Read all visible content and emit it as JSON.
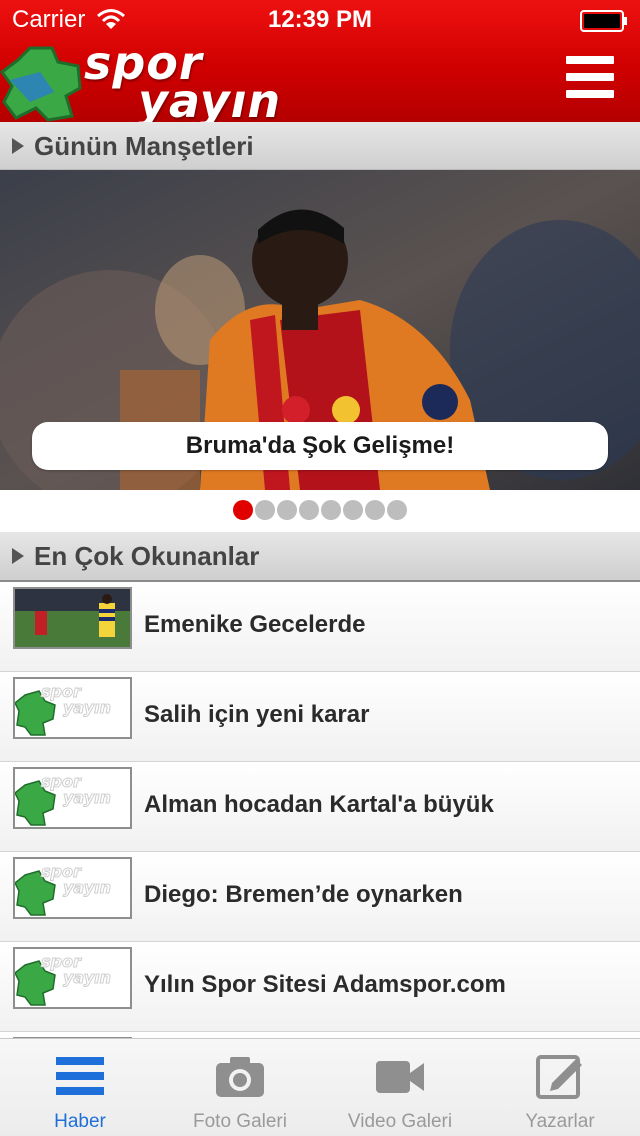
{
  "status_bar": {
    "carrier": "Carrier",
    "time": "12:39 PM"
  },
  "brand": {
    "logo_line1": "spor",
    "logo_line2": "yayın",
    "primary_color": "#d40000",
    "accent_green": "#3aa845"
  },
  "header": {
    "menu_icon": "hamburger-menu-icon"
  },
  "sections": {
    "headlines_title": "Günün Manşetleri",
    "most_read_title": "En Çok Okunanlar"
  },
  "carousel": {
    "caption": "Bruma'da Şok Gelişme!",
    "page_count": 8,
    "active_page": 1
  },
  "news_list": [
    {
      "title": "Emenike Gecelerde",
      "thumbnail": "photo"
    },
    {
      "title": "Salih için yeni karar",
      "thumbnail": "logo"
    },
    {
      "title": "Alman hocadan Kartal'a büyük",
      "thumbnail": "logo"
    },
    {
      "title": "Diego: Bremen’de oynarken",
      "thumbnail": "logo"
    },
    {
      "title": "Yılın Spor Sitesi Adamspor.com",
      "thumbnail": "logo"
    }
  ],
  "tab_bar": {
    "active_color": "#1e6fd9",
    "tabs": [
      {
        "label": "Haber",
        "icon": "news-list-icon",
        "active": true
      },
      {
        "label": "Foto Galeri",
        "icon": "camera-icon",
        "active": false
      },
      {
        "label": "Video Galeri",
        "icon": "video-camera-icon",
        "active": false
      },
      {
        "label": "Yazarlar",
        "icon": "edit-note-icon",
        "active": false
      }
    ]
  }
}
